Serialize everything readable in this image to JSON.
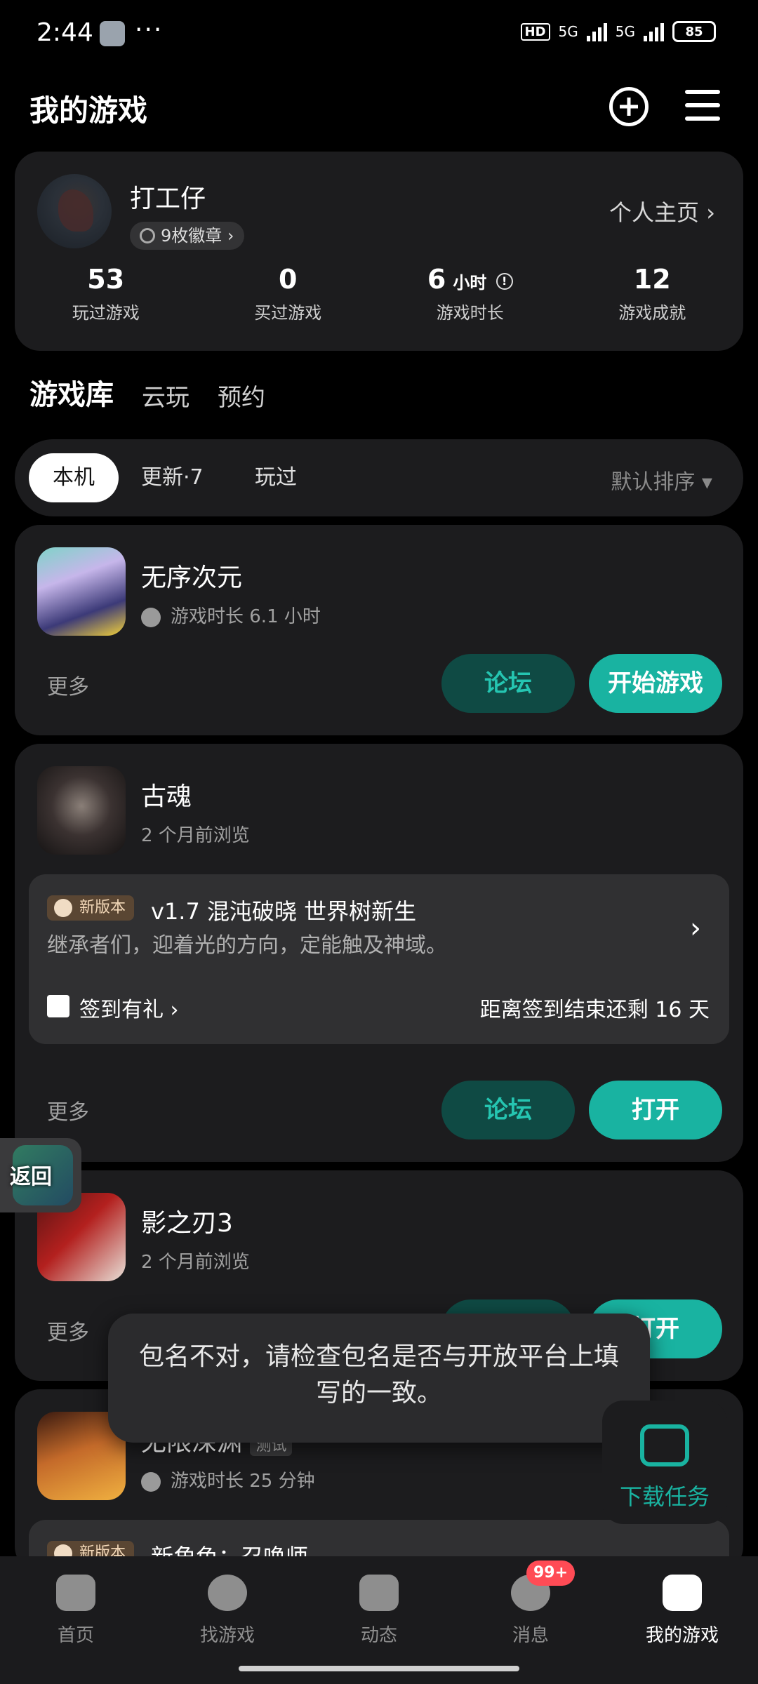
{
  "status": {
    "time": "2:44",
    "dots": "···",
    "battery": "85",
    "hd": "HD",
    "net1": "5G",
    "net2": "5G"
  },
  "appbar": {
    "title": "我的游戏"
  },
  "profile": {
    "name": "打工仔",
    "badges": "9枚徽章 ›",
    "homepage": "个人主页 ›",
    "stats": [
      {
        "num": "53",
        "label": "玩过游戏"
      },
      {
        "num": "0",
        "label": "买过游戏"
      },
      {
        "num": "6",
        "unit": "小时",
        "label": "游戏时长"
      },
      {
        "num": "12",
        "label": "游戏成就"
      }
    ]
  },
  "tabs": [
    "游戏库",
    "云玩",
    "预约"
  ],
  "filters": {
    "items": [
      "本机",
      "更新·7",
      "玩过"
    ],
    "sort": "默认排序 ▾"
  },
  "games": [
    {
      "name": "无序次元",
      "sub": "游戏时长 6.1 小时",
      "more": "更多",
      "forum": "论坛",
      "action": "开始游戏"
    },
    {
      "name": "古魂",
      "sub": "2 个月前浏览",
      "more": "更多",
      "forum": "论坛",
      "action": "打开",
      "update": {
        "tag": "新版本",
        "title": "v1.7 混沌破晓 世界树新生",
        "desc": "继承者们，迎着光的方向，定能触及神域。",
        "gift": "签到有礼 ›",
        "remain": "距离签到结束还剩 16 天"
      }
    },
    {
      "name": "影之刃3",
      "sub": "2 个月前浏览",
      "more": "更多",
      "action": "打开"
    },
    {
      "name": "无限深渊",
      "sub": "游戏时长 25 分钟",
      "tag": "测试",
      "update_tag": "新版本",
      "update_title": "新角色：召唤师"
    }
  ],
  "back_label": "返回",
  "toast": "包名不对，请检查包名是否与开放平台上填写的一致。",
  "download": "下载任务",
  "nav": [
    {
      "label": "首页"
    },
    {
      "label": "找游戏"
    },
    {
      "label": "动态"
    },
    {
      "label": "消息",
      "badge": "99+"
    },
    {
      "label": "我的游戏"
    }
  ],
  "colors": {
    "accent": "#19b3a1",
    "card": "#1c1c1e",
    "background": "#000000"
  }
}
